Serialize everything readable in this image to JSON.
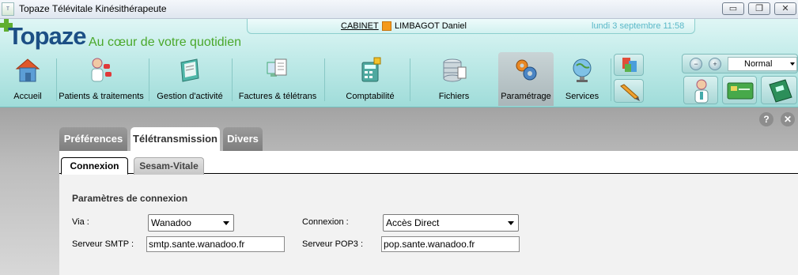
{
  "window": {
    "title": "Topaze Télévitale Kinésithérapeute",
    "minimize_glyph": "▭",
    "restore_glyph": "❐",
    "close_glyph": "✕"
  },
  "header": {
    "logo": "Topaze",
    "tagline": "Au cœur de votre quotidien",
    "cabinet_link": "CABINET",
    "user_name": "LIMBAGOT Daniel",
    "user_color": "#f49a1c",
    "date": "lundi 3 septembre 11:58"
  },
  "ribbon": {
    "items": [
      {
        "label": "Accueil",
        "icon": "house-icon"
      },
      {
        "label": "Patients & traitements",
        "icon": "patients-icon"
      },
      {
        "label": "Gestion d'activité",
        "icon": "activity-icon"
      },
      {
        "label": "Factures & télétrans",
        "icon": "invoices-icon"
      },
      {
        "label": "Comptabilité",
        "icon": "calculator-icon"
      },
      {
        "label": "Fichiers",
        "icon": "database-icon"
      },
      {
        "label": "Paramétrage",
        "icon": "gears-icon"
      },
      {
        "label": "Services",
        "icon": "globe-icon"
      }
    ],
    "zoom_value": "Normal"
  },
  "content": {
    "help_glyph": "?",
    "close_glyph": "✕",
    "tabs": [
      "Préférences",
      "Télétransmission",
      "Divers"
    ],
    "active_tab": "Télétransmission",
    "subtabs": [
      "Connexion",
      "Sesam-Vitale"
    ],
    "active_subtab": "Connexion",
    "section_title": "Paramètres de connexion",
    "form": {
      "via_label": "Via :",
      "via_value": "Wanadoo",
      "connexion_label": "Connexion :",
      "connexion_value": "Accès Direct",
      "smtp_label": "Serveur SMTP :",
      "smtp_value": "smtp.sante.wanadoo.fr",
      "pop3_label": "Serveur POP3 :",
      "pop3_value": "pop.sante.wanadoo.fr"
    }
  }
}
